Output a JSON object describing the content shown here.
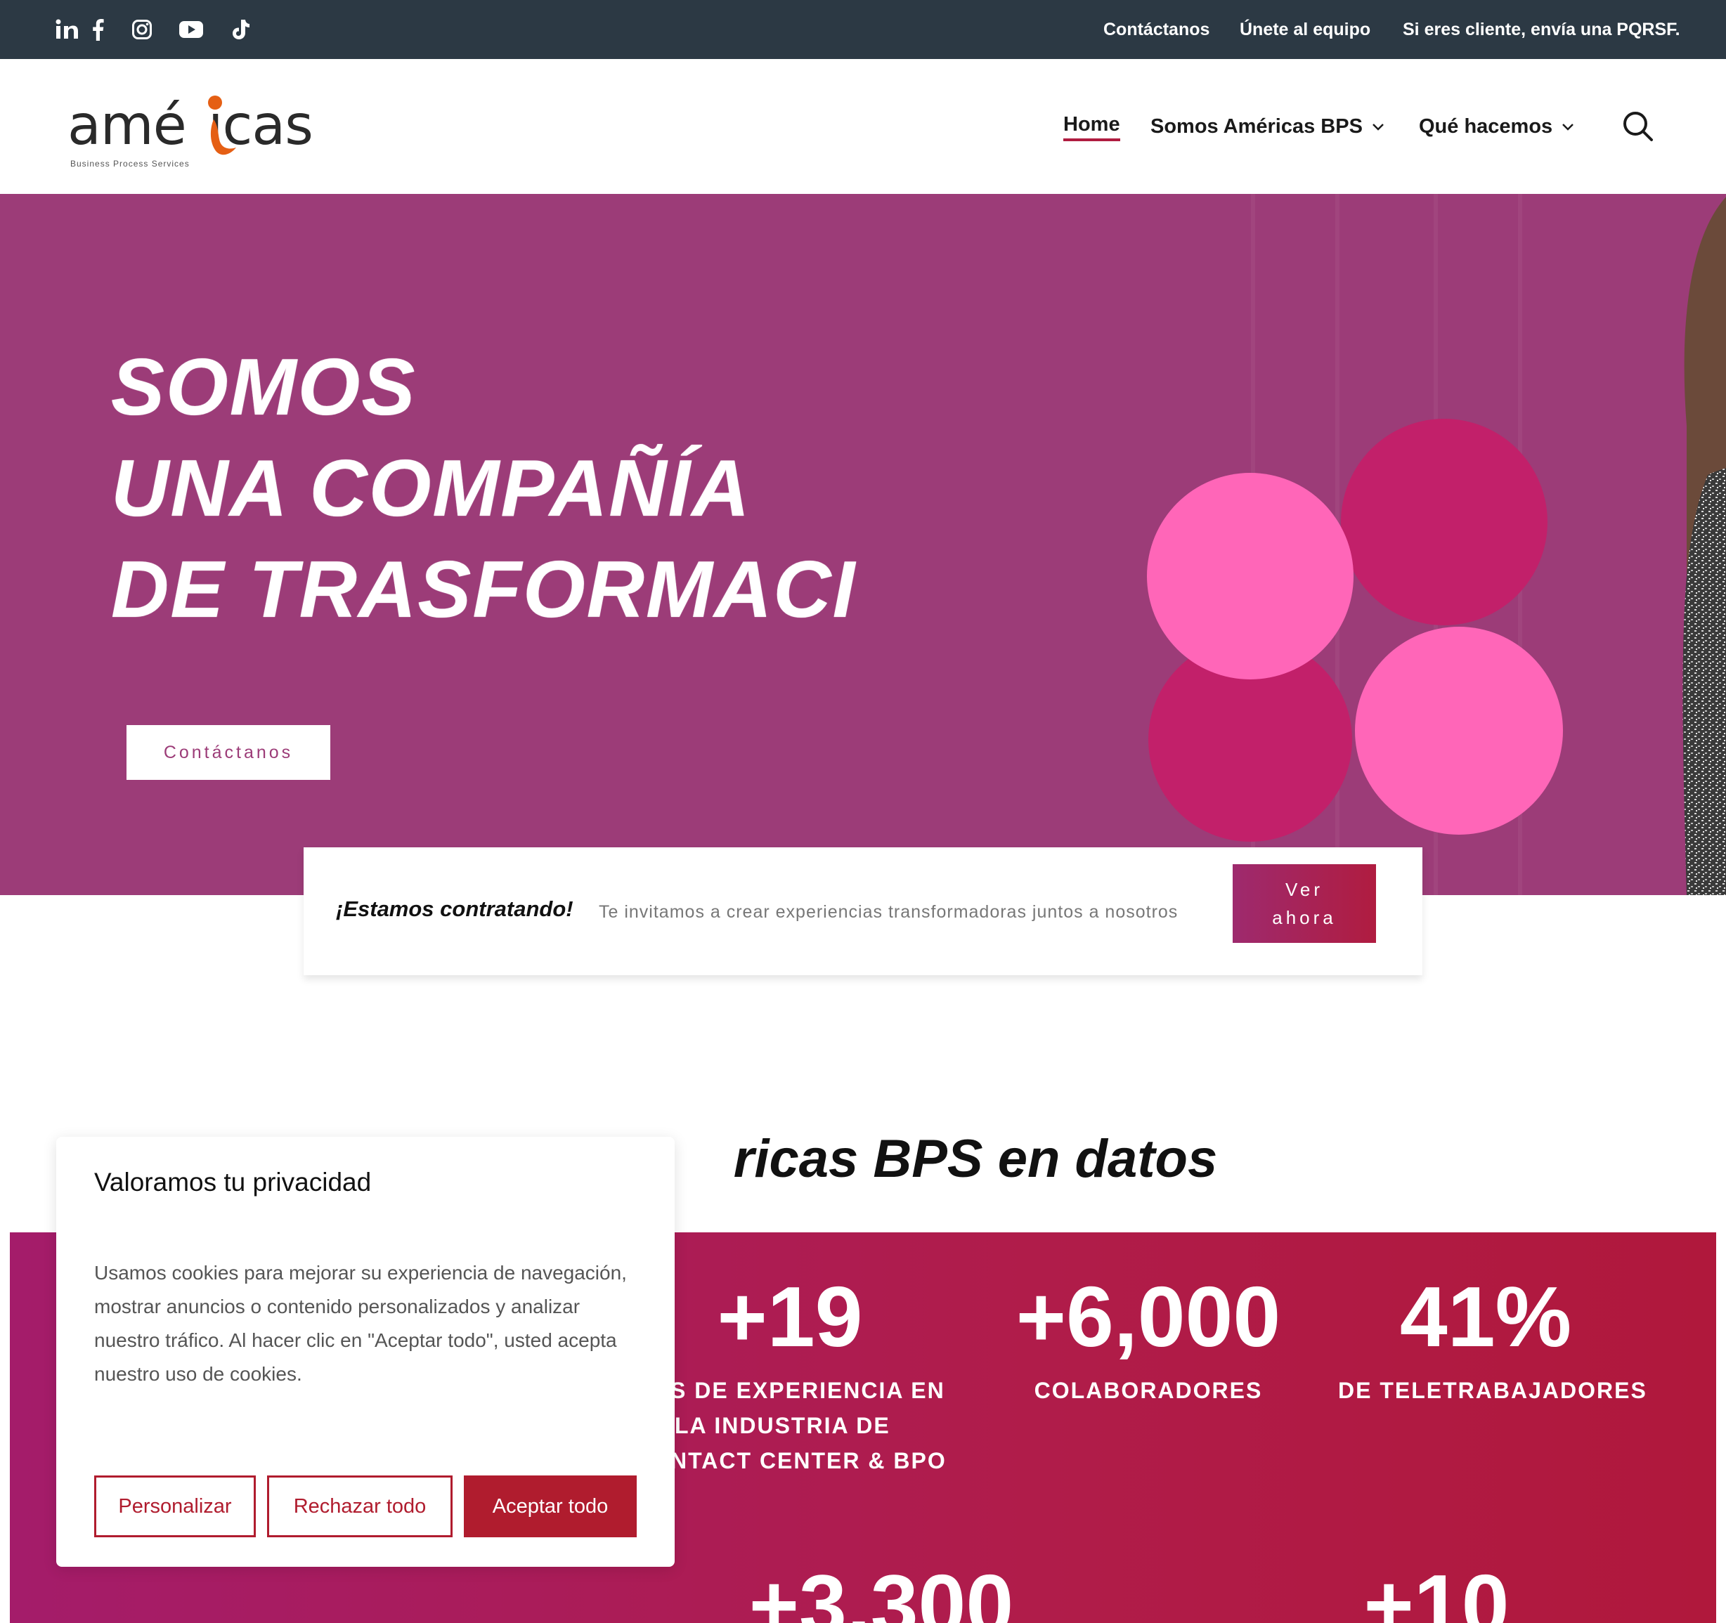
{
  "topbar": {
    "social_icons": [
      "linkedin-icon",
      "facebook-icon",
      "instagram-icon",
      "youtube-icon",
      "tiktok-icon"
    ],
    "links": [
      "Contáctanos",
      "Únete al equipo",
      "Si eres cliente, envía una PQRSF."
    ]
  },
  "header": {
    "logo": {
      "word": "améicas",
      "word_start": "amé",
      "word_mid": "r",
      "word_end": "icas",
      "tagline": "Business Process Services"
    },
    "nav": {
      "home": "Home",
      "about": "Somos Américas BPS",
      "services": "Qué hacemos"
    }
  },
  "hero": {
    "lines": [
      "SOMOS",
      "UNA COMPAÑÍA",
      "DE TRASFORMACI"
    ],
    "button": "Contáctanos"
  },
  "hiring": {
    "title": "¡Estamos contratando!",
    "description": "Te invitamos a crear experiencias transformadoras juntos a nosotros",
    "button_line1": "Ver",
    "button_line2": "ahora"
  },
  "stats": {
    "title_visible": "ricas BPS en datos",
    "items": [
      {
        "value": "+19",
        "label_lines": [
          "S DE EXPERIENCIA EN",
          "LA INDUSTRIA DE",
          "NTACT CENTER & BPO"
        ]
      },
      {
        "value": "+6,000",
        "label_lines": [
          "COLABORADORES"
        ]
      },
      {
        "value": "41%",
        "label_lines": [
          "DE TELETRABAJADORES"
        ]
      }
    ],
    "partial_values": [
      "+3,300",
      "+10"
    ]
  },
  "cookie": {
    "title": "Valoramos tu privacidad",
    "text": "Usamos cookies para mejorar su experiencia de navegación, mostrar anuncios o contenido personalizados y analizar nuestro tráfico. Al hacer clic en \"Aceptar todo\", usted acepta nuestro uso de cookies.",
    "buttons": {
      "customize": "Personalizar",
      "reject": "Rechazar todo",
      "accept": "Aceptar todo"
    }
  },
  "colors": {
    "topbar": "#2c3944",
    "hero_bg": "#9c3c78",
    "accent": "#b01c2e",
    "circle_light": "#ff66b8",
    "circle_dark": "#c2206a",
    "logo_orange": "#e55f14"
  }
}
